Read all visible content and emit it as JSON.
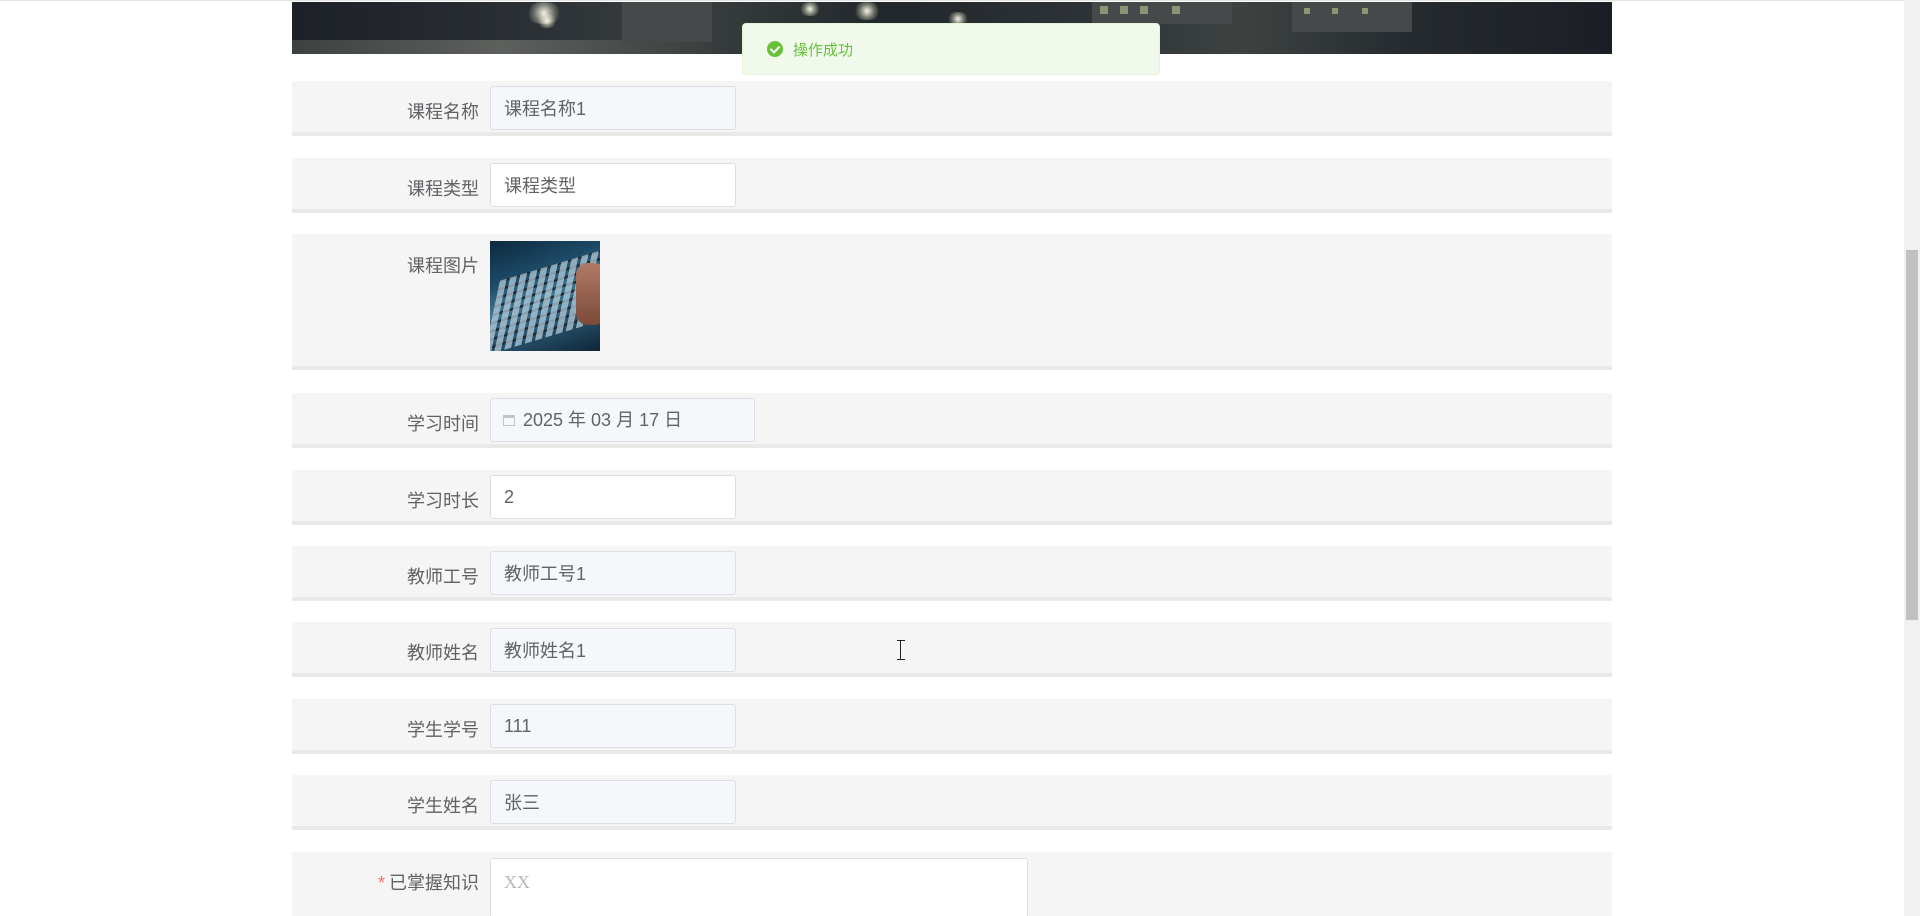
{
  "toast": {
    "message": "操作成功",
    "color": "#67c23a"
  },
  "form": {
    "course_name": {
      "label": "课程名称",
      "value": "课程名称1"
    },
    "course_type": {
      "label": "课程类型",
      "value": "课程类型"
    },
    "course_image": {
      "label": "课程图片"
    },
    "study_time": {
      "label": "学习时间",
      "value": "2025 年 03 月 17 日"
    },
    "study_duration": {
      "label": "学习时长",
      "value": "2"
    },
    "teacher_id": {
      "label": "教师工号",
      "value": "教师工号1"
    },
    "teacher_name": {
      "label": "教师姓名",
      "value": "教师姓名1"
    },
    "student_id": {
      "label": "学生学号",
      "value": "111"
    },
    "student_name": {
      "label": "学生姓名",
      "value": "张三"
    },
    "knowledge": {
      "label": "已掌握知识",
      "required_mark": "*",
      "value": "XX"
    }
  },
  "colors": {
    "row_bg": "#f5f5f5",
    "required": "#f56c6c",
    "success_bg": "#f0f9eb"
  },
  "icons": {
    "toast": "check-circle-icon",
    "date": "calendar-icon"
  }
}
